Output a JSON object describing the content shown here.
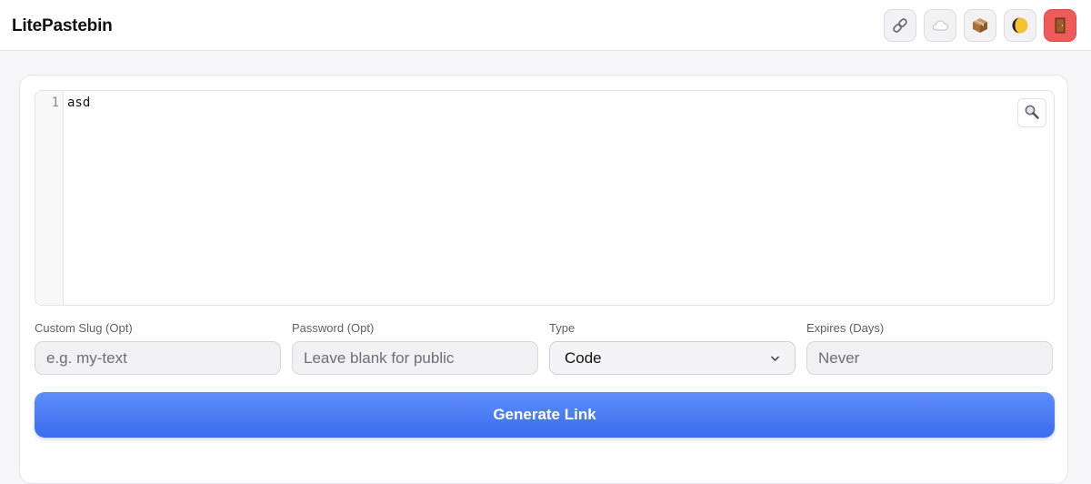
{
  "header": {
    "title": "LitePastebin",
    "tools": [
      {
        "icon": "link-icon"
      },
      {
        "icon": "cloud-icon"
      },
      {
        "icon": "package-icon"
      },
      {
        "icon": "theme-toggle-icon"
      },
      {
        "icon": "door-icon"
      }
    ]
  },
  "editor": {
    "line_numbers": [
      "1"
    ],
    "content": "asd",
    "search_icon": "search-icon"
  },
  "form": {
    "slug": {
      "label": "Custom Slug (Opt)",
      "placeholder": "e.g. my-text",
      "value": ""
    },
    "password": {
      "label": "Password (Opt)",
      "placeholder": "Leave blank for public",
      "value": ""
    },
    "type": {
      "label": "Type",
      "selected": "Code"
    },
    "expires": {
      "label": "Expires (Days)",
      "placeholder": "Never",
      "value": ""
    }
  },
  "actions": {
    "generate_label": "Generate Link"
  },
  "colors": {
    "accent": "#3a6cee",
    "danger": "#ef5b5b",
    "background": "#f6f6f8"
  }
}
